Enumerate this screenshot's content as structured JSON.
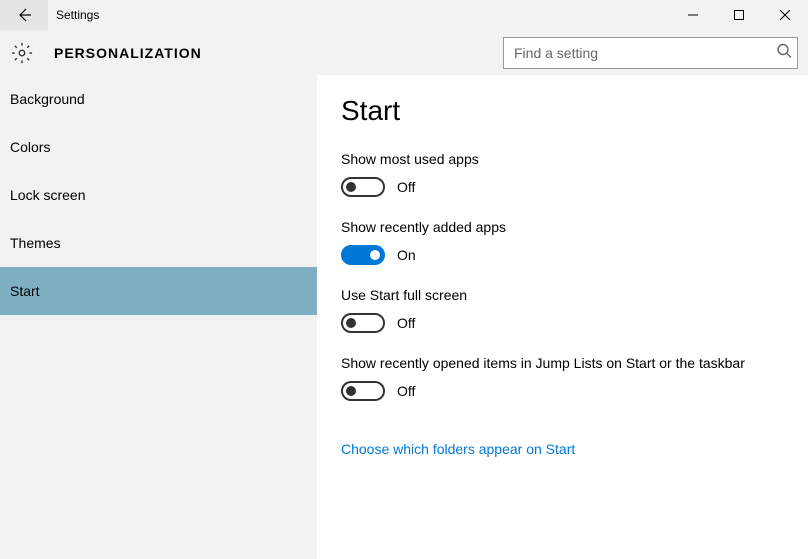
{
  "window": {
    "title": "Settings"
  },
  "header": {
    "title": "PERSONALIZATION",
    "search_placeholder": "Find a setting"
  },
  "sidebar": {
    "items": [
      {
        "label": "Background",
        "active": false
      },
      {
        "label": "Colors",
        "active": false
      },
      {
        "label": "Lock screen",
        "active": false
      },
      {
        "label": "Themes",
        "active": false
      },
      {
        "label": "Start",
        "active": true
      }
    ]
  },
  "content": {
    "heading": "Start",
    "settings": [
      {
        "label": "Show most used apps",
        "on": false,
        "state": "Off"
      },
      {
        "label": "Show recently added apps",
        "on": true,
        "state": "On"
      },
      {
        "label": "Use Start full screen",
        "on": false,
        "state": "Off"
      },
      {
        "label": "Show recently opened items in Jump Lists on Start or the taskbar",
        "on": false,
        "state": "Off"
      }
    ],
    "link": "Choose which folders appear on Start"
  },
  "colors": {
    "accent": "#0078d7",
    "sidebar_active": "#7eb0c1",
    "chrome_bg": "#f2f2f2"
  }
}
